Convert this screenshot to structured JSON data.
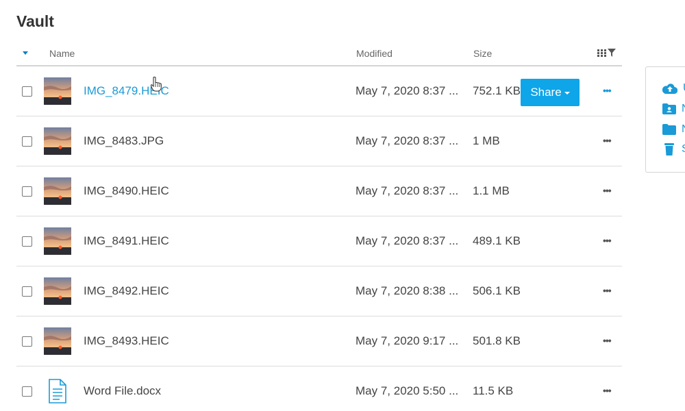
{
  "page": {
    "title": "Vault"
  },
  "table": {
    "headers": {
      "name": "Name",
      "modified": "Modified",
      "size": "Size"
    },
    "rows": [
      {
        "name": "IMG_8479.HEIC",
        "modified": "May 7, 2020 8:37 ...",
        "size": "752.1 KB",
        "type": "image",
        "hover": true
      },
      {
        "name": "IMG_8483.JPG",
        "modified": "May 7, 2020 8:37 ...",
        "size": "1 MB",
        "type": "image"
      },
      {
        "name": "IMG_8490.HEIC",
        "modified": "May 7, 2020 8:37 ...",
        "size": "1.1 MB",
        "type": "image"
      },
      {
        "name": "IMG_8491.HEIC",
        "modified": "May 7, 2020 8:37 ...",
        "size": "489.1 KB",
        "type": "image"
      },
      {
        "name": "IMG_8492.HEIC",
        "modified": "May 7, 2020 8:38 ...",
        "size": "506.1 KB",
        "type": "image"
      },
      {
        "name": "IMG_8493.HEIC",
        "modified": "May 7, 2020 9:17 ...",
        "size": "501.8 KB",
        "type": "image"
      },
      {
        "name": "Word File.docx",
        "modified": "May 7, 2020 5:50 ...",
        "size": "11.5 KB",
        "type": "document"
      }
    ],
    "share_label": "Share",
    "more_label": "•••"
  },
  "side_panel": {
    "items": [
      {
        "icon": "cloud-upload-icon",
        "label": "U"
      },
      {
        "icon": "shared-folder-icon",
        "label": "N"
      },
      {
        "icon": "folder-icon",
        "label": "N"
      },
      {
        "icon": "trash-icon",
        "label": "S"
      }
    ]
  },
  "colors": {
    "accent": "#0ea5e9",
    "link": "#1a9ad6",
    "text": "#444444"
  }
}
